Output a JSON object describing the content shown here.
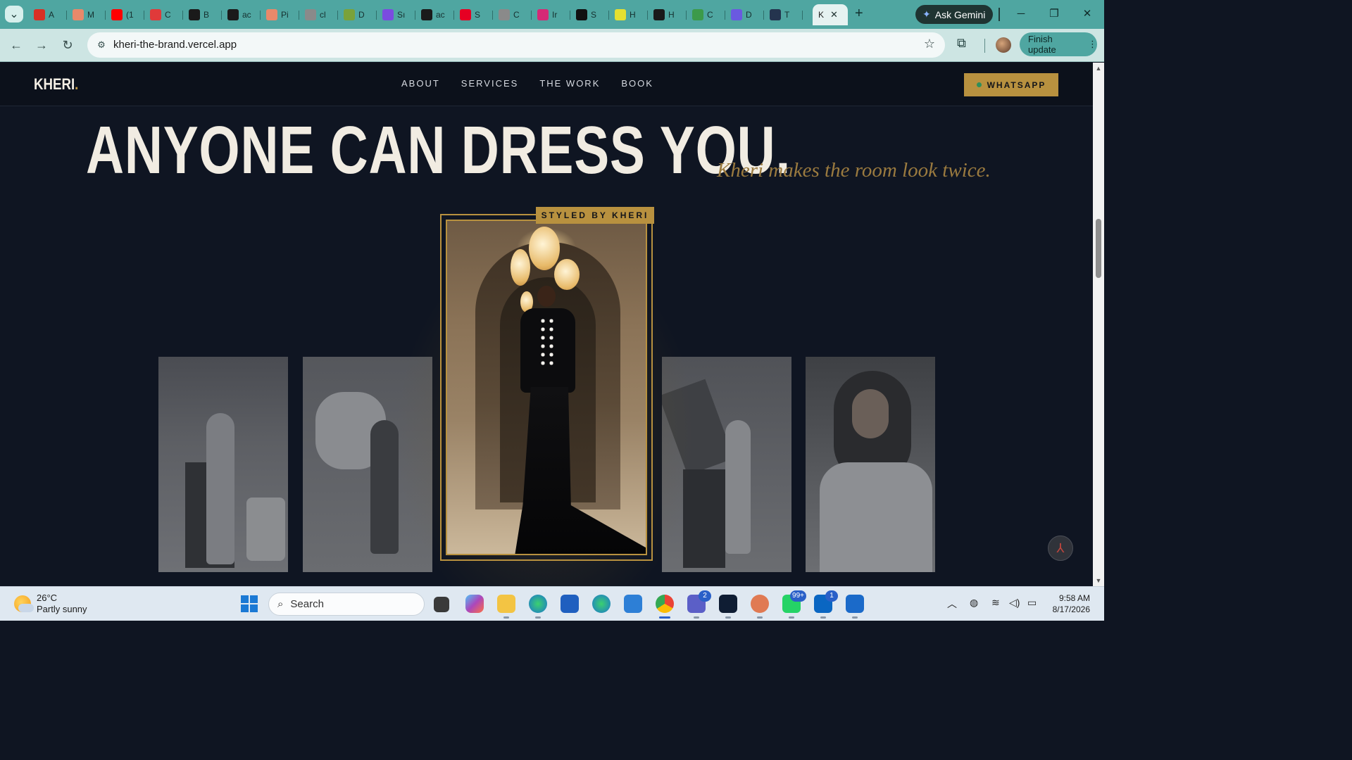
{
  "browser": {
    "tabs": [
      {
        "title": "A",
        "color": "#d93025"
      },
      {
        "title": "M",
        "color": "#e8896a"
      },
      {
        "title": "(1",
        "color": "#ff0000"
      },
      {
        "title": "C",
        "color": "#e03a3a"
      },
      {
        "title": "B",
        "color": "#1a1a1a"
      },
      {
        "title": "ac",
        "color": "#1a1a1a"
      },
      {
        "title": "Pi",
        "color": "#e8896a"
      },
      {
        "title": "cl",
        "color": "#8a8a8a"
      },
      {
        "title": "D",
        "color": "#7aa23a"
      },
      {
        "title": "Sı",
        "color": "#7b4ce0"
      },
      {
        "title": "ac",
        "color": "#1a1a1a"
      },
      {
        "title": "S",
        "color": "#e60023"
      },
      {
        "title": "C",
        "color": "#8a8a8a"
      },
      {
        "title": "Ir",
        "color": "#d62976"
      },
      {
        "title": "S",
        "color": "#111111"
      },
      {
        "title": "H",
        "color": "#e5e031"
      },
      {
        "title": "H",
        "color": "#1a1a1a"
      },
      {
        "title": "C",
        "color": "#3c9a4a"
      },
      {
        "title": "D",
        "color": "#6a5ae0"
      },
      {
        "title": "T",
        "color": "#24344e"
      }
    ],
    "active_tab": {
      "title": "K",
      "close": "✕"
    },
    "new_tab": "+",
    "ask_gemini": "Ask Gemini",
    "url": "kheri-the-brand.vercel.app",
    "finish_update": "Finish update",
    "window_controls": {
      "minimize": "─",
      "restore": "❐",
      "close": "✕"
    }
  },
  "site": {
    "logo": "KHERI",
    "logo_dot": ".",
    "nav": [
      "ABOUT",
      "SERVICES",
      "THE WORK",
      "BOOK"
    ],
    "whatsapp": "WHATSAPP",
    "headline": "ANYONE CAN DRESS YOU.",
    "tagline": "Kheri makes the room look twice.",
    "badge": "STYLED BY KHERI",
    "accent_color": "#b8913f",
    "background_color": "#0f1522"
  },
  "taskbar": {
    "weather_temp": "26°C",
    "weather_desc": "Partly sunny",
    "search_placeholder": "Search",
    "badges": {
      "teams": "2",
      "whatsapp": "99+",
      "linkedin": "1"
    },
    "time": "9:58 AM",
    "date": "8/17/2026"
  },
  "icons": [
    "search-icon",
    "back-arrow-icon",
    "forward-arrow-icon",
    "reload-icon",
    "site-info-icon",
    "bookmark-star-icon",
    "extensions-icon",
    "pdf-icon",
    "windows-start-icon",
    "wifi-icon",
    "volume-icon",
    "battery-icon"
  ]
}
